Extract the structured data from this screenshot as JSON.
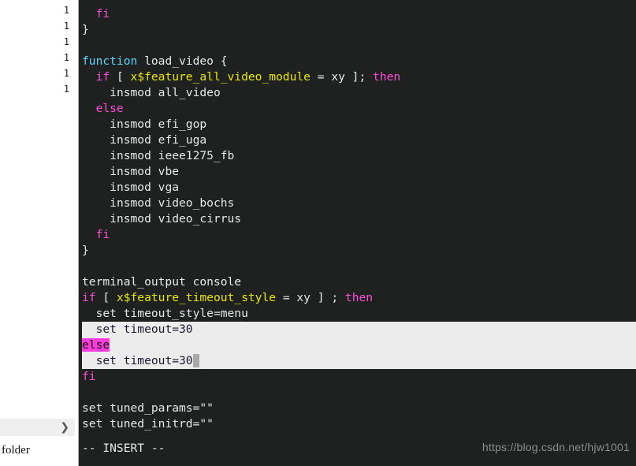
{
  "sidebar": {
    "gutter_line_numbers": [
      "1",
      "1",
      "1",
      "1",
      "1",
      "1"
    ],
    "expand_chevron": "❯",
    "folder_label": "folder"
  },
  "editor": {
    "mode_status": "-- INSERT --",
    "watermark": "https://blog.csdn.net/hjw1001",
    "colors": {
      "background": "#1f2020",
      "foreground": "#e8e8e8",
      "keyword": "#ff4fd8",
      "function": "#5fd7ff",
      "variable": "#e8e800",
      "selection_bg": "#ececec",
      "selection_fg": "#1a1a2e",
      "search_match_bg": "#ff3ddc",
      "cursor_bg": "#a9a9a9",
      "sidebar_bg": "#ffffff",
      "sidebar_row_bg": "#efefef"
    },
    "lines": [
      {
        "indent": 0,
        "selected": false,
        "tokens": []
      },
      {
        "indent": 2,
        "selected": false,
        "tokens": [
          {
            "t": "fi",
            "c": "kw"
          }
        ]
      },
      {
        "indent": 0,
        "selected": false,
        "tokens": [
          {
            "t": "}",
            "c": "plain"
          }
        ]
      },
      {
        "indent": 0,
        "selected": false,
        "tokens": []
      },
      {
        "indent": 0,
        "selected": false,
        "tokens": [
          {
            "t": "function",
            "c": "fn"
          },
          {
            "t": " load_video {",
            "c": "plain"
          }
        ]
      },
      {
        "indent": 2,
        "selected": false,
        "tokens": [
          {
            "t": "if",
            "c": "kw"
          },
          {
            "t": " [ ",
            "c": "plain"
          },
          {
            "t": "x$feature_all_video_module",
            "c": "var"
          },
          {
            "t": " = xy ]; ",
            "c": "plain"
          },
          {
            "t": "then",
            "c": "kw"
          }
        ]
      },
      {
        "indent": 4,
        "selected": false,
        "tokens": [
          {
            "t": "insmod all_video",
            "c": "plain"
          }
        ]
      },
      {
        "indent": 2,
        "selected": false,
        "tokens": [
          {
            "t": "else",
            "c": "kw"
          }
        ]
      },
      {
        "indent": 4,
        "selected": false,
        "tokens": [
          {
            "t": "insmod efi_gop",
            "c": "plain"
          }
        ]
      },
      {
        "indent": 4,
        "selected": false,
        "tokens": [
          {
            "t": "insmod efi_uga",
            "c": "plain"
          }
        ]
      },
      {
        "indent": 4,
        "selected": false,
        "tokens": [
          {
            "t": "insmod ieee1275_fb",
            "c": "plain"
          }
        ]
      },
      {
        "indent": 4,
        "selected": false,
        "tokens": [
          {
            "t": "insmod vbe",
            "c": "plain"
          }
        ]
      },
      {
        "indent": 4,
        "selected": false,
        "tokens": [
          {
            "t": "insmod vga",
            "c": "plain"
          }
        ]
      },
      {
        "indent": 4,
        "selected": false,
        "tokens": [
          {
            "t": "insmod video_bochs",
            "c": "plain"
          }
        ]
      },
      {
        "indent": 4,
        "selected": false,
        "tokens": [
          {
            "t": "insmod video_cirrus",
            "c": "plain"
          }
        ]
      },
      {
        "indent": 2,
        "selected": false,
        "tokens": [
          {
            "t": "fi",
            "c": "kw"
          }
        ]
      },
      {
        "indent": 0,
        "selected": false,
        "tokens": [
          {
            "t": "}",
            "c": "plain"
          }
        ]
      },
      {
        "indent": 0,
        "selected": false,
        "tokens": []
      },
      {
        "indent": 0,
        "selected": false,
        "tokens": [
          {
            "t": "terminal_output console",
            "c": "plain"
          }
        ]
      },
      {
        "indent": 0,
        "selected": false,
        "tokens": [
          {
            "t": "if",
            "c": "kw"
          },
          {
            "t": " [ ",
            "c": "plain"
          },
          {
            "t": "x$feature_timeout_style",
            "c": "var"
          },
          {
            "t": " = xy ] ; ",
            "c": "plain"
          },
          {
            "t": "then",
            "c": "kw"
          }
        ]
      },
      {
        "indent": 2,
        "selected": false,
        "tokens": [
          {
            "t": "set timeout_style=menu",
            "c": "plain"
          }
        ]
      },
      {
        "indent": 2,
        "selected": true,
        "tokens": [
          {
            "t": "set timeout=30",
            "c": "plain"
          }
        ]
      },
      {
        "indent": 0,
        "selected": true,
        "tokens": [
          {
            "t": "else",
            "c": "match"
          }
        ]
      },
      {
        "indent": 2,
        "selected": true,
        "tokens": [
          {
            "t": "set timeout=30",
            "c": "plain"
          },
          {
            "t": " ",
            "c": "cursor"
          }
        ]
      },
      {
        "indent": 0,
        "selected": false,
        "tokens": [
          {
            "t": "fi",
            "c": "kw"
          }
        ]
      },
      {
        "indent": 0,
        "selected": false,
        "tokens": []
      },
      {
        "indent": 0,
        "selected": false,
        "tokens": [
          {
            "t": "set tuned_params=\"\"",
            "c": "plain"
          }
        ]
      },
      {
        "indent": 0,
        "selected": false,
        "tokens": [
          {
            "t": "set tuned_initrd=\"\"",
            "c": "plain"
          }
        ]
      }
    ]
  }
}
